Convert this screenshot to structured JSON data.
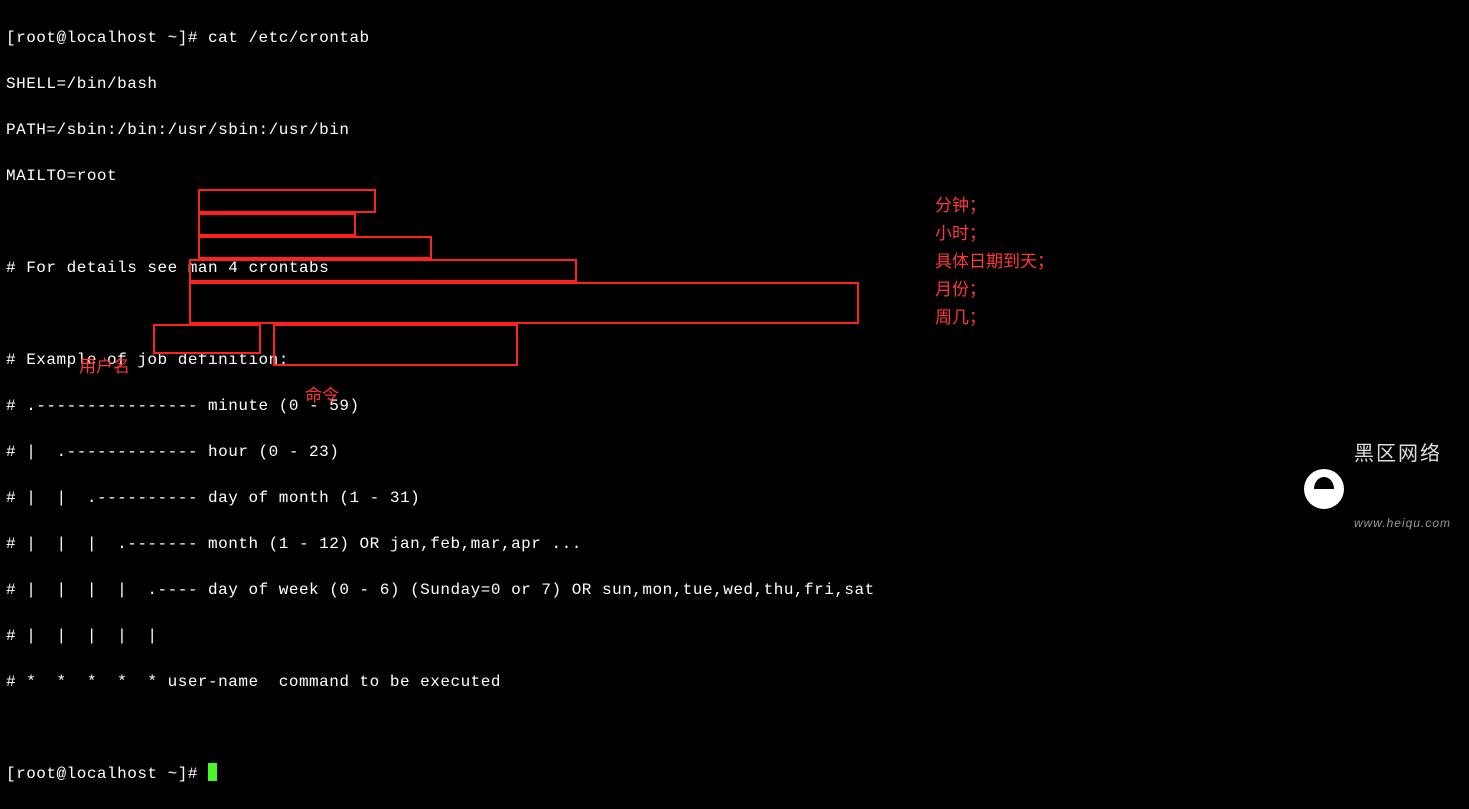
{
  "prompt1": "[root@localhost ~]# ",
  "cmd1": "cat /etc/crontab",
  "lines": [
    "SHELL=/bin/bash",
    "PATH=/sbin:/bin:/usr/sbin:/usr/bin",
    "MAILTO=root",
    "",
    "# For details see man 4 crontabs",
    "",
    "# Example of job definition:",
    "# .---------------- minute (0 - 59)",
    "# |  .------------- hour (0 - 23)",
    "# |  |  .---------- day of month (1 - 31)",
    "# |  |  |  .------- month (1 - 12) OR jan,feb,mar,apr ...",
    "# |  |  |  |  .---- day of week (0 - 6) (Sunday=0 or 7) OR sun,mon,tue,wed,thu,fri,sat",
    "# |  |  |  |  |",
    "# *  *  *  *  * user-name  command to be executed",
    ""
  ],
  "prompt2": "[root@localhost ~]# ",
  "annotations": {
    "right": [
      "分钟；",
      "小时；",
      "具体日期到天；",
      "月份；",
      "周几；"
    ],
    "username": "用户名",
    "command": "命令"
  },
  "watermark": {
    "icon": "mushroom-icon",
    "title": "黑区网络",
    "url": "www.heiqu.com"
  }
}
